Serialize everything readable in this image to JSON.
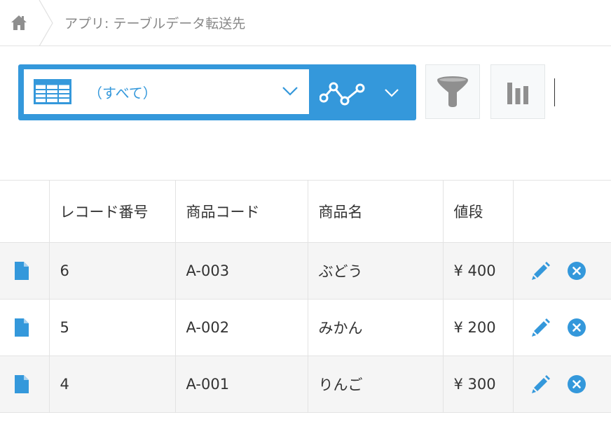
{
  "breadcrumb": {
    "home_icon": "home-icon",
    "text": "アプリ: テーブルデータ転送先"
  },
  "view_selector": {
    "icon": "table-icon",
    "label": "（すべて）"
  },
  "graph_selector": {
    "icon": "line-graph-icon"
  },
  "toolbar": {
    "filter_icon": "filter-icon",
    "stats_icon": "bar-chart-icon"
  },
  "table": {
    "columns": [
      "",
      "レコード番号",
      "商品コード",
      "商品名",
      "値段",
      ""
    ],
    "rows": [
      {
        "record_number": "6",
        "product_code": "A-003",
        "product_name": "ぶどう",
        "price": "¥ 400"
      },
      {
        "record_number": "5",
        "product_code": "A-002",
        "product_name": "みかん",
        "price": "¥ 200"
      },
      {
        "record_number": "4",
        "product_code": "A-001",
        "product_name": "りんご",
        "price": "¥ 300"
      }
    ],
    "row_icons": {
      "detail": "document-icon",
      "edit": "pencil-icon",
      "delete": "close-circle-icon"
    }
  },
  "colors": {
    "accent": "#3498db",
    "breadcrumb_text": "#888888",
    "icon_gray": "#8f8f8f",
    "row_stripe": "#f5f5f5"
  }
}
